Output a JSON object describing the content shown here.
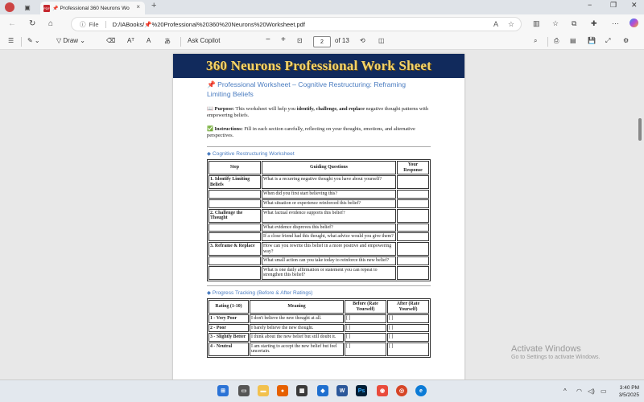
{
  "browser": {
    "tab_title": "Professional 360 Neurons Wo",
    "tab_close": "×",
    "new_tab": "+",
    "window_controls": [
      "−",
      "❐",
      "✕"
    ],
    "url_scheme_label": "File",
    "url": "D:/IABooks/📌%20Professional%20360%20Neurons%20Worksheet.pdf"
  },
  "pdf_toolbar": {
    "draw_label": "Draw",
    "copilot_label": "Ask Copilot",
    "zoom_out": "−",
    "zoom_in": "+",
    "current_page": "2",
    "page_total": "of 13"
  },
  "document": {
    "banner": "360 Neurons Professional Work Sheet",
    "title": "📌 Professional Worksheet – Cognitive Restructuring: Reframing Limiting Beliefs",
    "purpose_label": "📖 Purpose:",
    "purpose_text_1": " This worksheet will help you ",
    "purpose_bold": "identify, challenge, and replace",
    "purpose_text_2": " negative thought patterns with empowering beliefs.",
    "instructions_label": "✅ Instructions:",
    "instructions_text": " Fill in each section carefully, reflecting on your thoughts, emotions, and alternative perspectives.",
    "section1_title": "◆ Cognitive Restructuring Worksheet",
    "table1": {
      "headers": [
        "Step",
        "Guiding Questions",
        "Your Response"
      ],
      "rows": [
        [
          "1. Identify Limiting Beliefs",
          "What is a recurring negative thought you have about yourself?",
          ""
        ],
        [
          "",
          "When did you first start believing this?",
          ""
        ],
        [
          "",
          "What situation or experience reinforced this belief?",
          ""
        ],
        [
          "2. Challenge the Thought",
          "What factual evidence supports this belief?",
          ""
        ],
        [
          "",
          "What evidence disproves this belief?",
          ""
        ],
        [
          "",
          "If a close friend had this thought, what advice would you give them?",
          ""
        ],
        [
          "3. Reframe & Replace",
          "How can you rewrite this belief in a more positive and empowering way?",
          ""
        ],
        [
          "",
          "What small action can you take today to reinforce this new belief?",
          ""
        ],
        [
          "",
          "What is one daily affirmation or statement you can repeat to strengthen this belief?",
          ""
        ]
      ]
    },
    "section2_title": "◆ Progress Tracking (Before & After Ratings)",
    "table2": {
      "headers": [
        "Rating (1-10)",
        "Meaning",
        "Before (Rate Yourself)",
        "After (Rate Yourself)"
      ],
      "rows": [
        [
          "1 - Very Poor",
          "I don't believe the new thought at all.",
          "[ ]",
          "[ ]"
        ],
        [
          "2 - Poor",
          "I barely believe the new thought.",
          "[ ]",
          "[ ]"
        ],
        [
          "3 - Slightly Better",
          "I think about the new belief but still doubt it.",
          "[ ]",
          "[ ]"
        ],
        [
          "4 - Neutral",
          "I am starting to accept the new belief but feel uncertain.",
          "[ ]",
          "[ ]"
        ]
      ]
    }
  },
  "watermark": {
    "line1": "Activate Windows",
    "line2": "Go to Settings to activate Windows."
  },
  "taskbar": {
    "time": "3:40 PM",
    "date": "3/5/2025"
  }
}
